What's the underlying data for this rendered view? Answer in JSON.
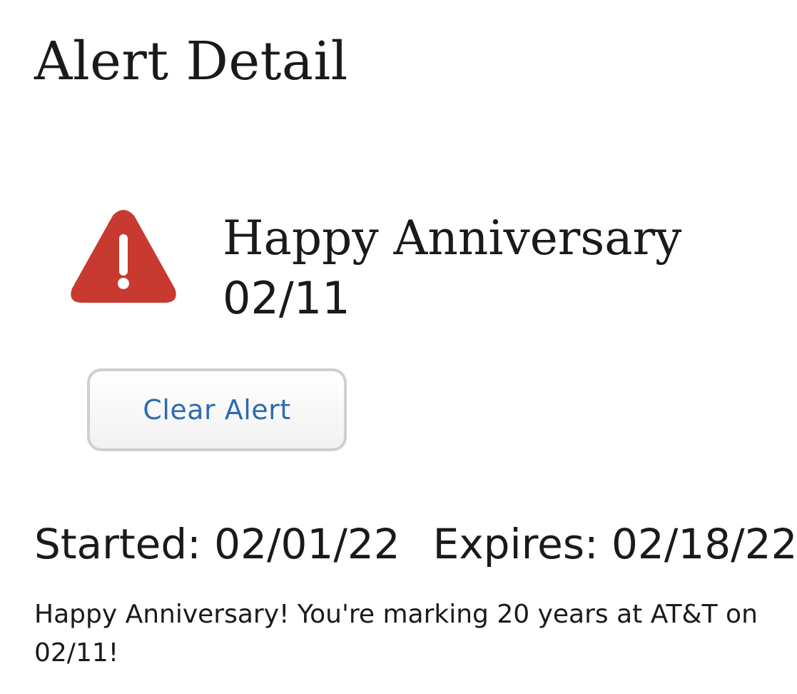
{
  "page": {
    "title": "Alert Detail"
  },
  "alert": {
    "icon": "warning-triangle-icon",
    "icon_color": "#c8392f",
    "headline_line1": "Happy Anniversary",
    "headline_line2": "02/11",
    "clear_button_label": "Clear Alert",
    "started_label": "Started:",
    "started_value": "02/01/22",
    "expires_label": "Expires:",
    "expires_value": "02/18/22",
    "message_line1": "Happy Anniversary! You're marking 20 years at AT&T on",
    "message_line2": "02/11!"
  },
  "colors": {
    "link_blue": "#2b6cb0",
    "text": "#1a1a1a"
  }
}
